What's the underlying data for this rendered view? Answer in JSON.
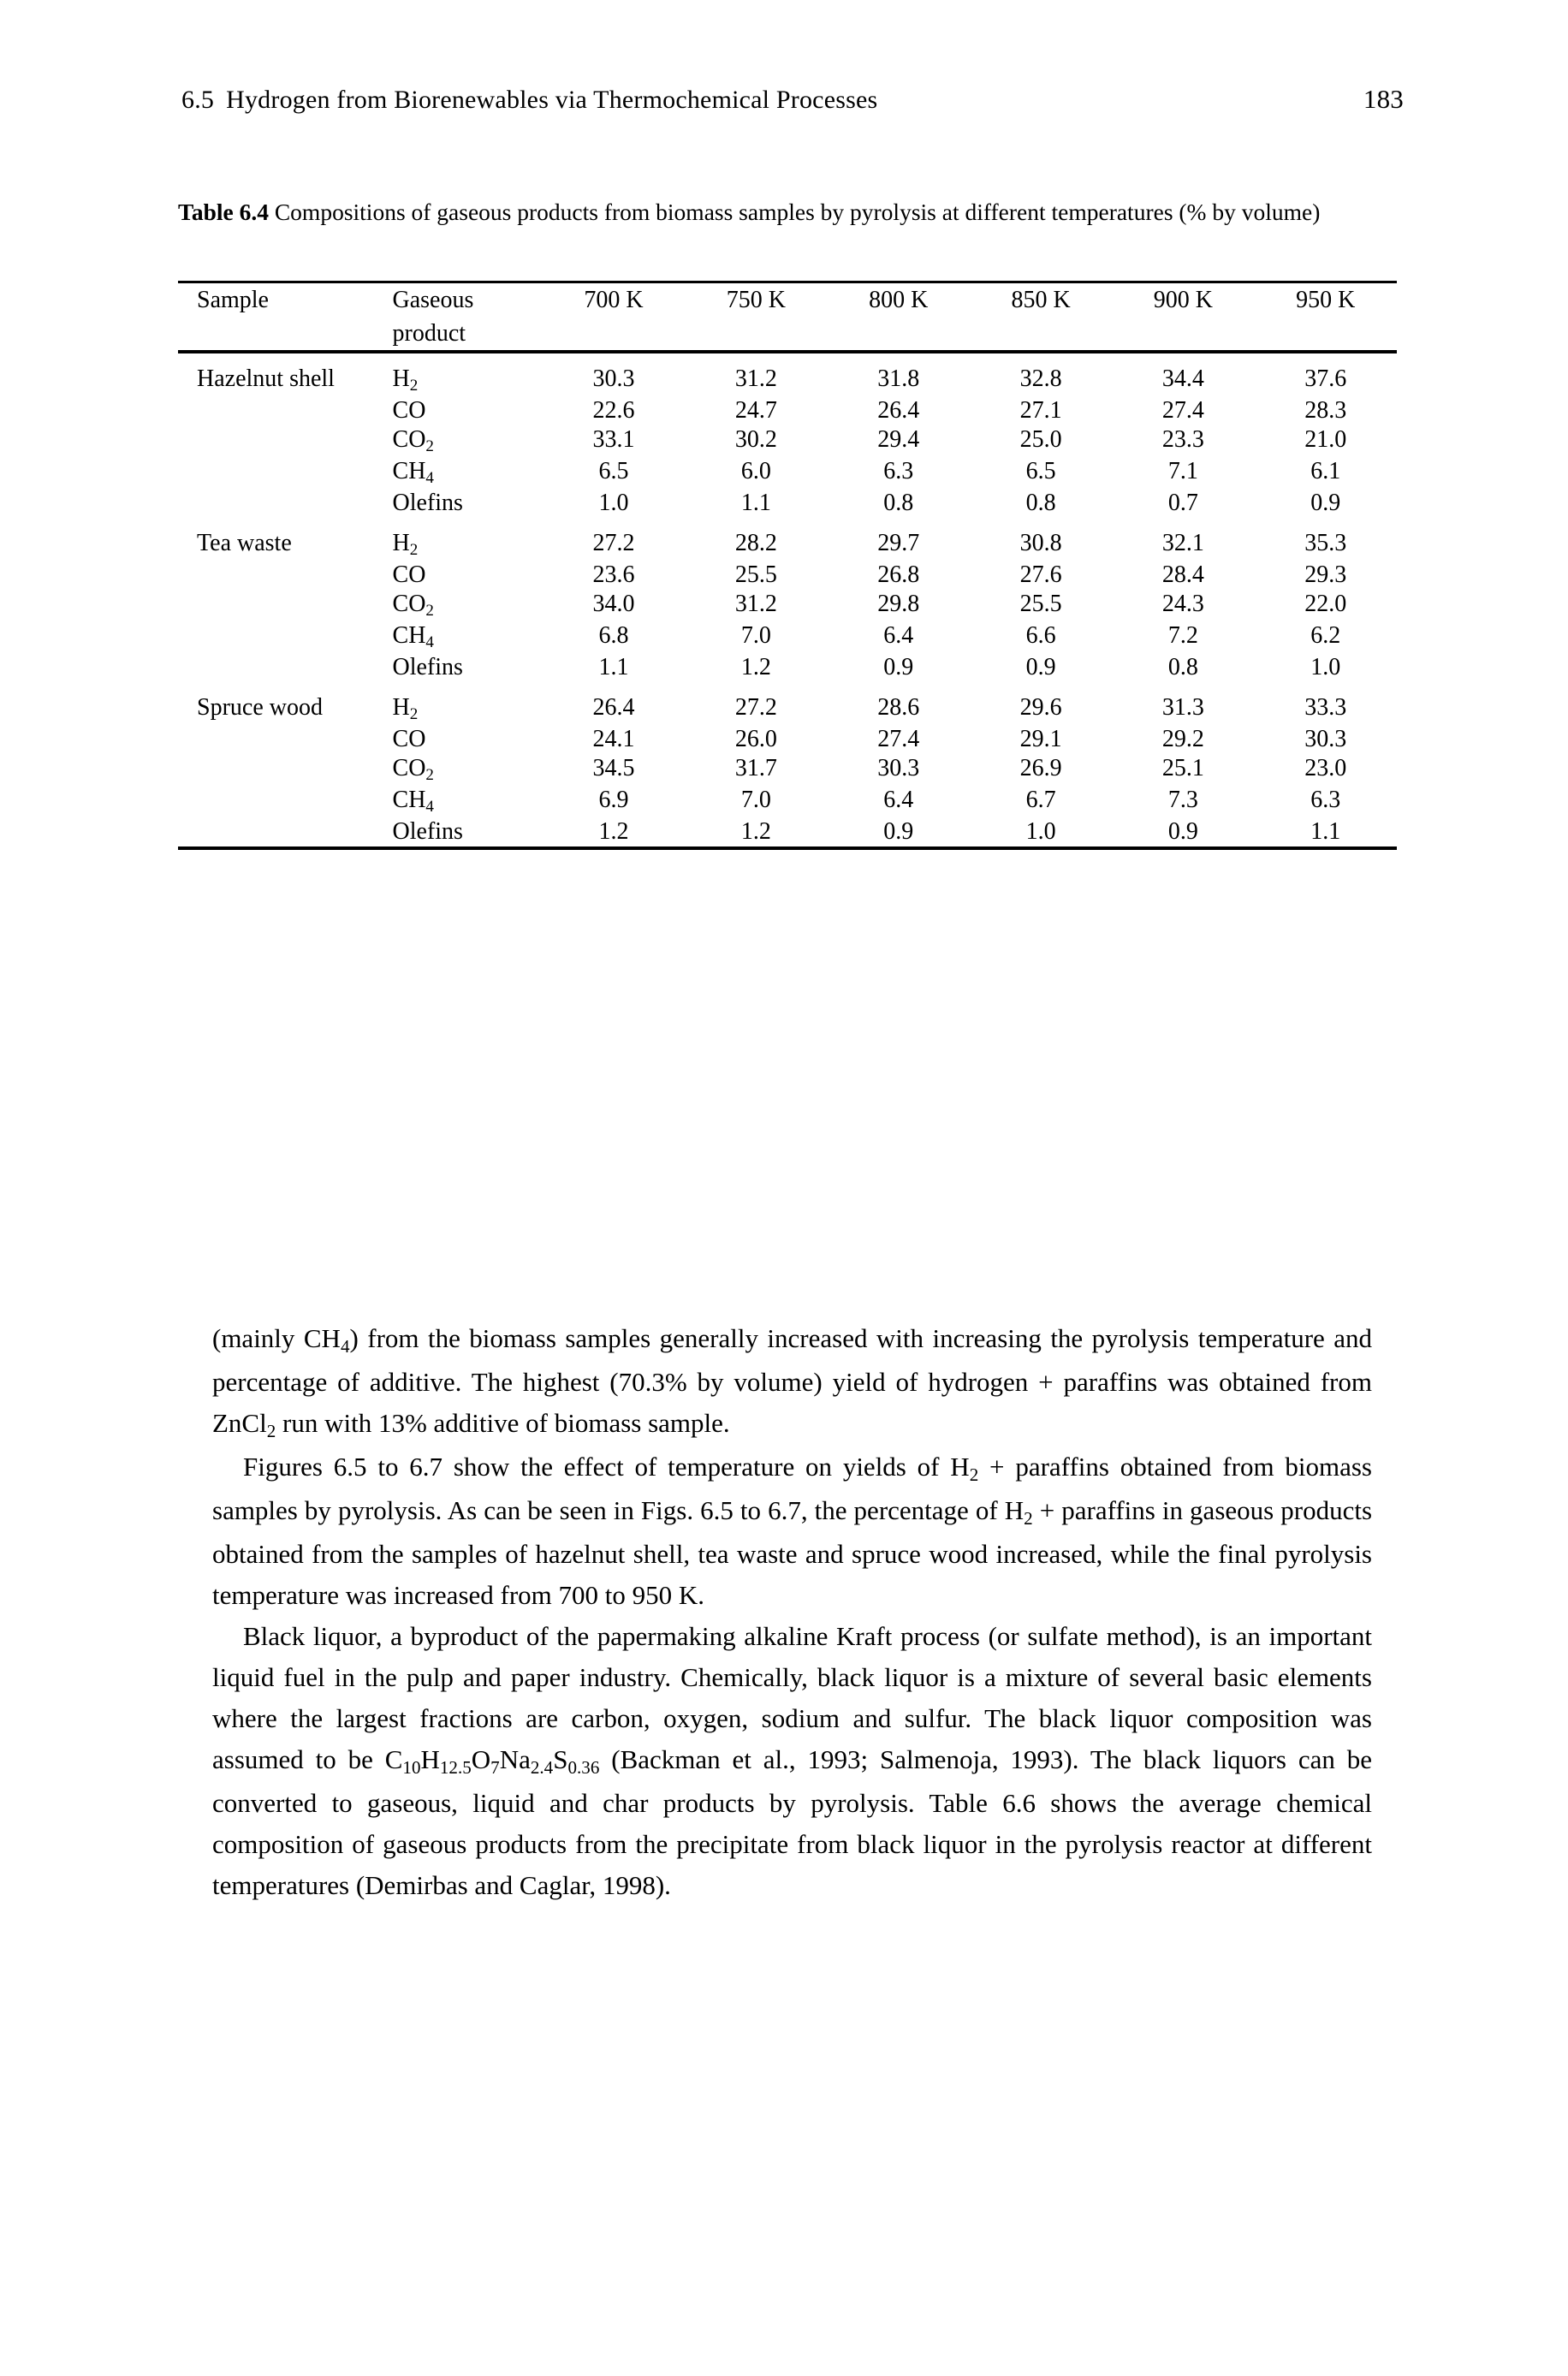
{
  "header": {
    "section_number": "6.5",
    "section_title": "Hydrogen from Biorenewables via Thermochemical Processes",
    "page_number": "183"
  },
  "table": {
    "caption_label": "Table 6.4",
    "caption_text": "Compositions of gaseous products from biomass samples by pyrolysis at different temperatures (% by volume)",
    "columns": [
      "Sample",
      "Gaseous product",
      "700 K",
      "750 K",
      "800 K",
      "850 K",
      "900 K",
      "950 K"
    ],
    "header": {
      "sample": "Sample",
      "gaseous_product_line1": "Gaseous",
      "gaseous_product_line2": "product",
      "t700": "700 K",
      "t750": "750 K",
      "t800": "800 K",
      "t850": "850 K",
      "t900": "900 K",
      "t950": "950 K"
    },
    "rows": [
      {
        "sample": "Hazelnut shell",
        "product": "H2",
        "v700": "30.3",
        "v750": "31.2",
        "v800": "31.8",
        "v850": "32.8",
        "v900": "34.4",
        "v950": "37.6"
      },
      {
        "sample": "",
        "product": "CO",
        "v700": "22.6",
        "v750": "24.7",
        "v800": "26.4",
        "v850": "27.1",
        "v900": "27.4",
        "v950": "28.3"
      },
      {
        "sample": "",
        "product": "CO2",
        "v700": "33.1",
        "v750": "30.2",
        "v800": "29.4",
        "v850": "25.0",
        "v900": "23.3",
        "v950": "21.0"
      },
      {
        "sample": "",
        "product": "CH4",
        "v700": "6.5",
        "v750": "6.0",
        "v800": "6.3",
        "v850": "6.5",
        "v900": "7.1",
        "v950": "6.1"
      },
      {
        "sample": "",
        "product": "Olefins",
        "v700": "1.0",
        "v750": "1.1",
        "v800": "0.8",
        "v850": "0.8",
        "v900": "0.7",
        "v950": "0.9"
      },
      {
        "sample": "Tea waste",
        "product": "H2",
        "v700": "27.2",
        "v750": "28.2",
        "v800": "29.7",
        "v850": "30.8",
        "v900": "32.1",
        "v950": "35.3"
      },
      {
        "sample": "",
        "product": "CO",
        "v700": "23.6",
        "v750": "25.5",
        "v800": "26.8",
        "v850": "27.6",
        "v900": "28.4",
        "v950": "29.3"
      },
      {
        "sample": "",
        "product": "CO2",
        "v700": "34.0",
        "v750": "31.2",
        "v800": "29.8",
        "v850": "25.5",
        "v900": "24.3",
        "v950": "22.0"
      },
      {
        "sample": "",
        "product": "CH4",
        "v700": "6.8",
        "v750": "7.0",
        "v800": "6.4",
        "v850": "6.6",
        "v900": "7.2",
        "v950": "6.2"
      },
      {
        "sample": "",
        "product": "Olefins",
        "v700": "1.1",
        "v750": "1.2",
        "v800": "0.9",
        "v850": "0.9",
        "v900": "0.8",
        "v950": "1.0"
      },
      {
        "sample": "Spruce wood",
        "product": "H2",
        "v700": "26.4",
        "v750": "27.2",
        "v800": "28.6",
        "v850": "29.6",
        "v900": "31.3",
        "v950": "33.3"
      },
      {
        "sample": "",
        "product": "CO",
        "v700": "24.1",
        "v750": "26.0",
        "v800": "27.4",
        "v850": "29.1",
        "v900": "29.2",
        "v950": "30.3"
      },
      {
        "sample": "",
        "product": "CO2",
        "v700": "34.5",
        "v750": "31.7",
        "v800": "30.3",
        "v850": "26.9",
        "v900": "25.1",
        "v950": "23.0"
      },
      {
        "sample": "",
        "product": "CH4",
        "v700": "6.9",
        "v750": "7.0",
        "v800": "6.4",
        "v850": "6.7",
        "v900": "7.3",
        "v950": "6.3"
      },
      {
        "sample": "",
        "product": "Olefins",
        "v700": "1.2",
        "v750": "1.2",
        "v800": "0.9",
        "v850": "1.0",
        "v900": "0.9",
        "v950": "1.1"
      }
    ]
  },
  "body": {
    "paragraph_1": "(mainly CH4) from the biomass samples generally increased with increasing the pyrolysis temperature and percentage of additive. The highest (70.3% by volume) yield of hydrogen + paraffins was obtained from ZnCl2 run with 13% additive of biomass sample.",
    "paragraph_2": "Figures 6.5 to 6.7 show the effect of temperature on yields of H2 + paraffins obtained from biomass samples by pyrolysis. As can be seen in Figs. 6.5 to 6.7, the percentage of H2 + paraffins in gaseous products obtained from the samples of hazelnut shell, tea waste and spruce wood increased, while the final pyrolysis temperature was increased from 700 to 950 K.",
    "paragraph_3": "Black liquor, a byproduct of the papermaking alkaline Kraft process (or sulfate method), is an important liquid fuel in the pulp and paper industry. Chemically, black liquor is a mixture of several basic elements where the largest fractions are carbon, oxygen, sodium and sulfur. The black liquor composition was assumed to be C10H12.5O7Na2.4S0.36 (Backman et al., 1993; Salmenoja, 1993). The black liquors can be converted to gaseous, liquid and char products by pyrolysis. Table 6.6 shows the average chemical composition of gaseous products from the precipitate from black liquor in the pyrolysis reactor at different temperatures (Demirbas and Caglar, 1998)."
  },
  "colors": {
    "page_background": "#ffffff",
    "text": "#000000",
    "rule": "#000000"
  }
}
